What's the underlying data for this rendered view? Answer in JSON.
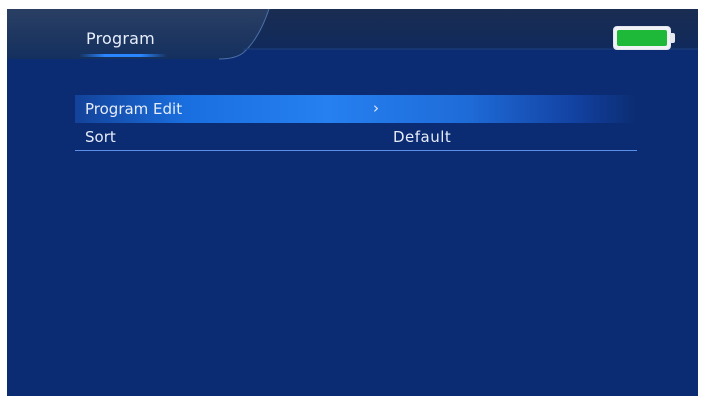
{
  "header": {
    "title": "Program",
    "battery_level": 1.0,
    "battery_color": "#1fb93a",
    "accent_color": "#2a86ff",
    "background_color": "#0b2c72"
  },
  "menu": {
    "items": [
      {
        "label": "Program Edit",
        "indicator": "›",
        "selected": true
      },
      {
        "label": "Sort",
        "value": "Default",
        "selected": false
      }
    ]
  }
}
